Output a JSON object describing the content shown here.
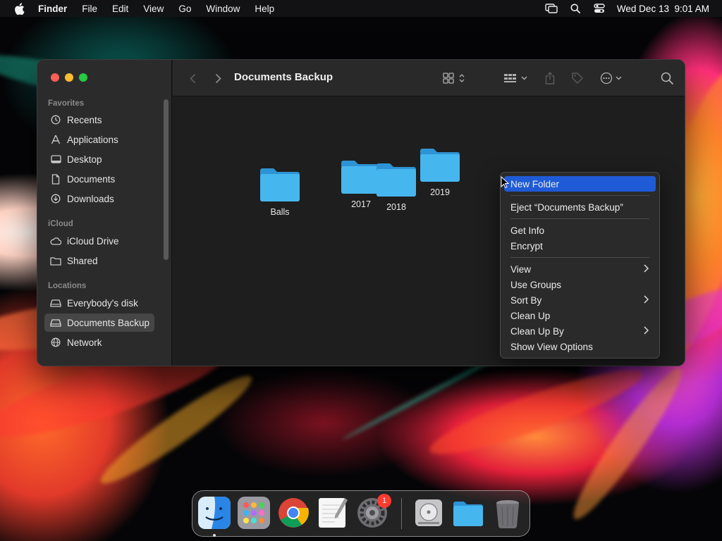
{
  "menubar": {
    "app_name": "Finder",
    "items": [
      "File",
      "Edit",
      "View",
      "Go",
      "Window",
      "Help"
    ],
    "datetime": "Wed Dec 13  9:01 AM"
  },
  "window": {
    "title": "Documents Backup"
  },
  "sidebar": {
    "favorites_header": "Favorites",
    "favorites": [
      "Recents",
      "Applications",
      "Desktop",
      "Documents",
      "Downloads"
    ],
    "icloud_header": "iCloud",
    "icloud": [
      "iCloud Drive",
      "Shared"
    ],
    "locations_header": "Locations",
    "locations": [
      "Everybody's disk",
      "Documents Backup",
      "Network"
    ],
    "selected": "Documents Backup"
  },
  "folders": [
    "Balls",
    "2017",
    "2018",
    "2019"
  ],
  "context_menu": {
    "items": [
      {
        "label": "New Folder",
        "highlighted": true
      },
      {
        "label": "Eject “Documents Backup”"
      },
      {
        "label": "Get Info"
      },
      {
        "label": "Encrypt"
      },
      {
        "label": "View",
        "submenu": true
      },
      {
        "label": "Use Groups"
      },
      {
        "label": "Sort By",
        "submenu": true
      },
      {
        "label": "Clean Up"
      },
      {
        "label": "Clean Up By",
        "submenu": true
      },
      {
        "label": "Show View Options"
      }
    ]
  },
  "dock": {
    "apps": [
      "finder-icon",
      "launchpad-icon",
      "chrome-icon",
      "textedit-icon",
      "system-settings-icon",
      "disk-utility-icon",
      "folder-icon",
      "trash-icon"
    ],
    "settings_badge": "1"
  },
  "colors": {
    "highlight": "#1f5bd6",
    "folder": "#3aa8e6",
    "badge": "#fe3b30"
  }
}
